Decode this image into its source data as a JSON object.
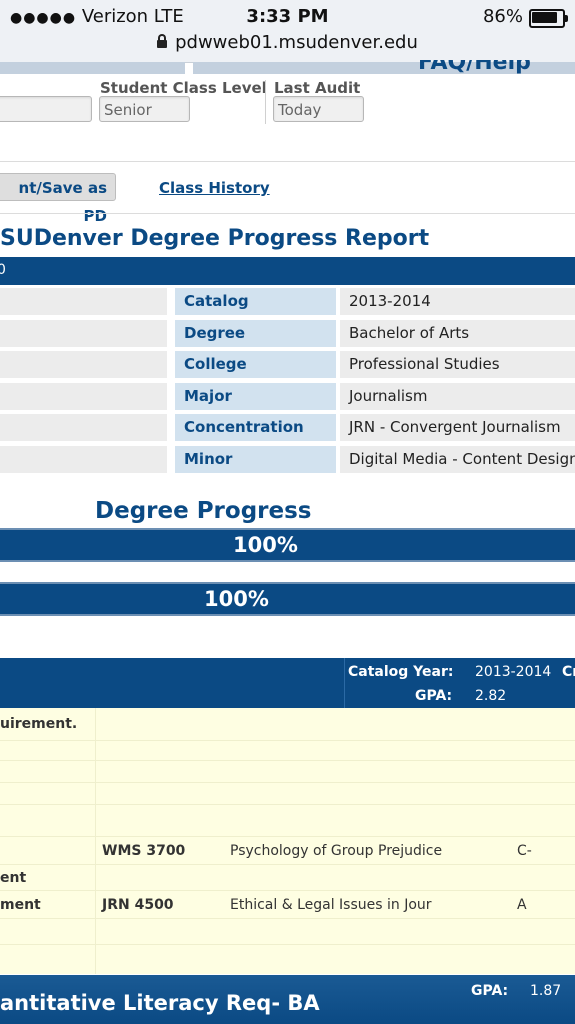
{
  "status_bar": {
    "carrier_dots": "●●●●●",
    "carrier": "Verizon  LTE",
    "time": "3:33 PM",
    "battery": "86%",
    "url": "pdwweb01.msudenver.edu"
  },
  "header": {
    "faq_link": "FAQ/Help",
    "student_class_level_label": "Student Class Level",
    "student_class_level_value": "Senior",
    "last_audit_label": "Last Audit",
    "last_audit_value": "Today"
  },
  "actions": {
    "print_save_label": "nt/Save as PD",
    "class_history_label": "Class History"
  },
  "report": {
    "title": "SUDenver Degree Progress Report",
    "bar_text": "0",
    "rows": [
      {
        "key": "Catalog",
        "value": "2013-2014"
      },
      {
        "key": "Degree",
        "value": "Bachelor of Arts"
      },
      {
        "key": "College",
        "value": "Professional Studies"
      },
      {
        "key": "Major",
        "value": "Journalism"
      },
      {
        "key": "Concentration",
        "value": "JRN - Convergent Journalism"
      },
      {
        "key": "Minor",
        "value": "Digital Media - Content Design"
      }
    ]
  },
  "degree_progress": {
    "title": "Degree Progress",
    "bar1_text": "100%",
    "bar1_fraction": 1.0,
    "bar2_text": "100%",
    "bar2_fraction": 1.0
  },
  "requirement": {
    "catalog_year_label": "Catalog Year:",
    "catalog_year_value": "2013-2014",
    "cut_label": "Cr",
    "gpa_label": "GPA:",
    "gpa_value": "2.82",
    "note": "uirement.",
    "courses": [
      {
        "left": "",
        "code": "WMS 3700",
        "title": "Psychology of Group Prejudice",
        "grade": "C-"
      },
      {
        "left": "ent",
        "code": "",
        "title": "",
        "grade": ""
      },
      {
        "left": "ment",
        "code": "JRN 4500",
        "title": "Ethical & Legal Issues in Jour",
        "grade": "A"
      }
    ]
  },
  "next_requirement": {
    "title": "antitative Literacy Req- BA",
    "gpa_label": "GPA:",
    "gpa_value": "1.87"
  },
  "colors": {
    "brand_blue": "#0b4a84",
    "key_cell": "#d2e2ef",
    "yellow_panel": "#fefee2"
  }
}
